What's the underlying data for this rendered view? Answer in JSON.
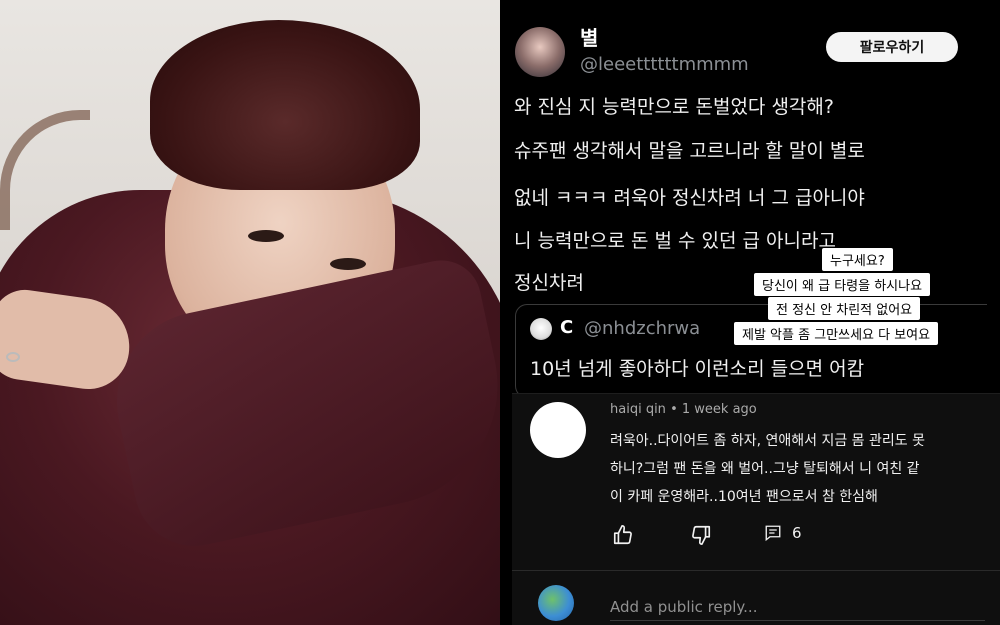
{
  "tweet": {
    "display_name": "별",
    "handle": "@leeettttttmmmm",
    "follow_label": "팔로우하기",
    "lines": [
      "와 진심 지 능력만으로 돈벌었다 생각해?",
      "슈주팬 생각해서 말을 고르니라 할 말이 별로",
      "없네 ㅋㅋㅋ 려욱아 정신차려 너 그 급아니야",
      "니 능력만으로 돈 벌 수 있던 급 아니라고",
      "정신차려"
    ]
  },
  "reply_stickers": [
    "누구세요?",
    "당신이 왜 급 타령을 하시나요",
    "전 정신 안 차린적 없어요",
    "제발 악플 좀 그만쓰세요 다 보여요"
  ],
  "quote": {
    "name": "C",
    "handle": "@nhdzchrwa",
    "text": "10년 넘게 좋아하다 이런소리 들으면 어캄"
  },
  "youtube_comment": {
    "author": "haiqi qin",
    "time": "1 week ago",
    "lines": [
      "려욱아..다이어트 좀 하자, 연애해서 지금 몸 관리도 못",
      "하니?그럼 팬 돈을 왜 벌어..그냥 탈퇴해서 니 여친 같",
      "이 카페 운영해라..10여년 팬으로서 참 한심해"
    ],
    "reply_count": "6",
    "reply_placeholder": "Add a public reply...",
    "icons": {
      "like": "thumbs-up-icon",
      "dislike": "thumbs-down-icon",
      "reply": "comment-icon",
      "user": "globe-icon"
    }
  }
}
